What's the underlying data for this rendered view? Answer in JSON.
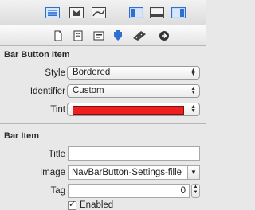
{
  "toolbar": {
    "buttons": [
      {
        "icon": "list-lines-icon"
      },
      {
        "icon": "library-icon"
      },
      {
        "icon": "diagonal-icon"
      },
      {
        "icon": "left-panel-icon"
      },
      {
        "icon": "bottom-panel-icon"
      },
      {
        "icon": "right-panel-icon"
      }
    ]
  },
  "inspector_tabs": [
    {
      "icon": "file-icon"
    },
    {
      "icon": "quick-help-icon"
    },
    {
      "icon": "identity-icon"
    },
    {
      "icon": "attributes-icon"
    },
    {
      "icon": "size-ruler-icon"
    },
    {
      "icon": "connections-arrow-icon"
    }
  ],
  "bar_button_item": {
    "title": "Bar Button Item",
    "style_label": "Style",
    "style_value": "Bordered",
    "identifier_label": "Identifier",
    "identifier_value": "Custom",
    "tint_label": "Tint",
    "tint_color": "#ee1f1f"
  },
  "bar_item": {
    "title": "Bar Item",
    "title_label": "Title",
    "title_value": "",
    "image_label": "Image",
    "image_value": "NavBarButton-Settings-fille",
    "tag_label": "Tag",
    "tag_value": "0",
    "enabled_label": "Enabled"
  },
  "colors": {
    "accent_blue": "#2f6fd0",
    "panel_bg": "#e8e8e8"
  }
}
